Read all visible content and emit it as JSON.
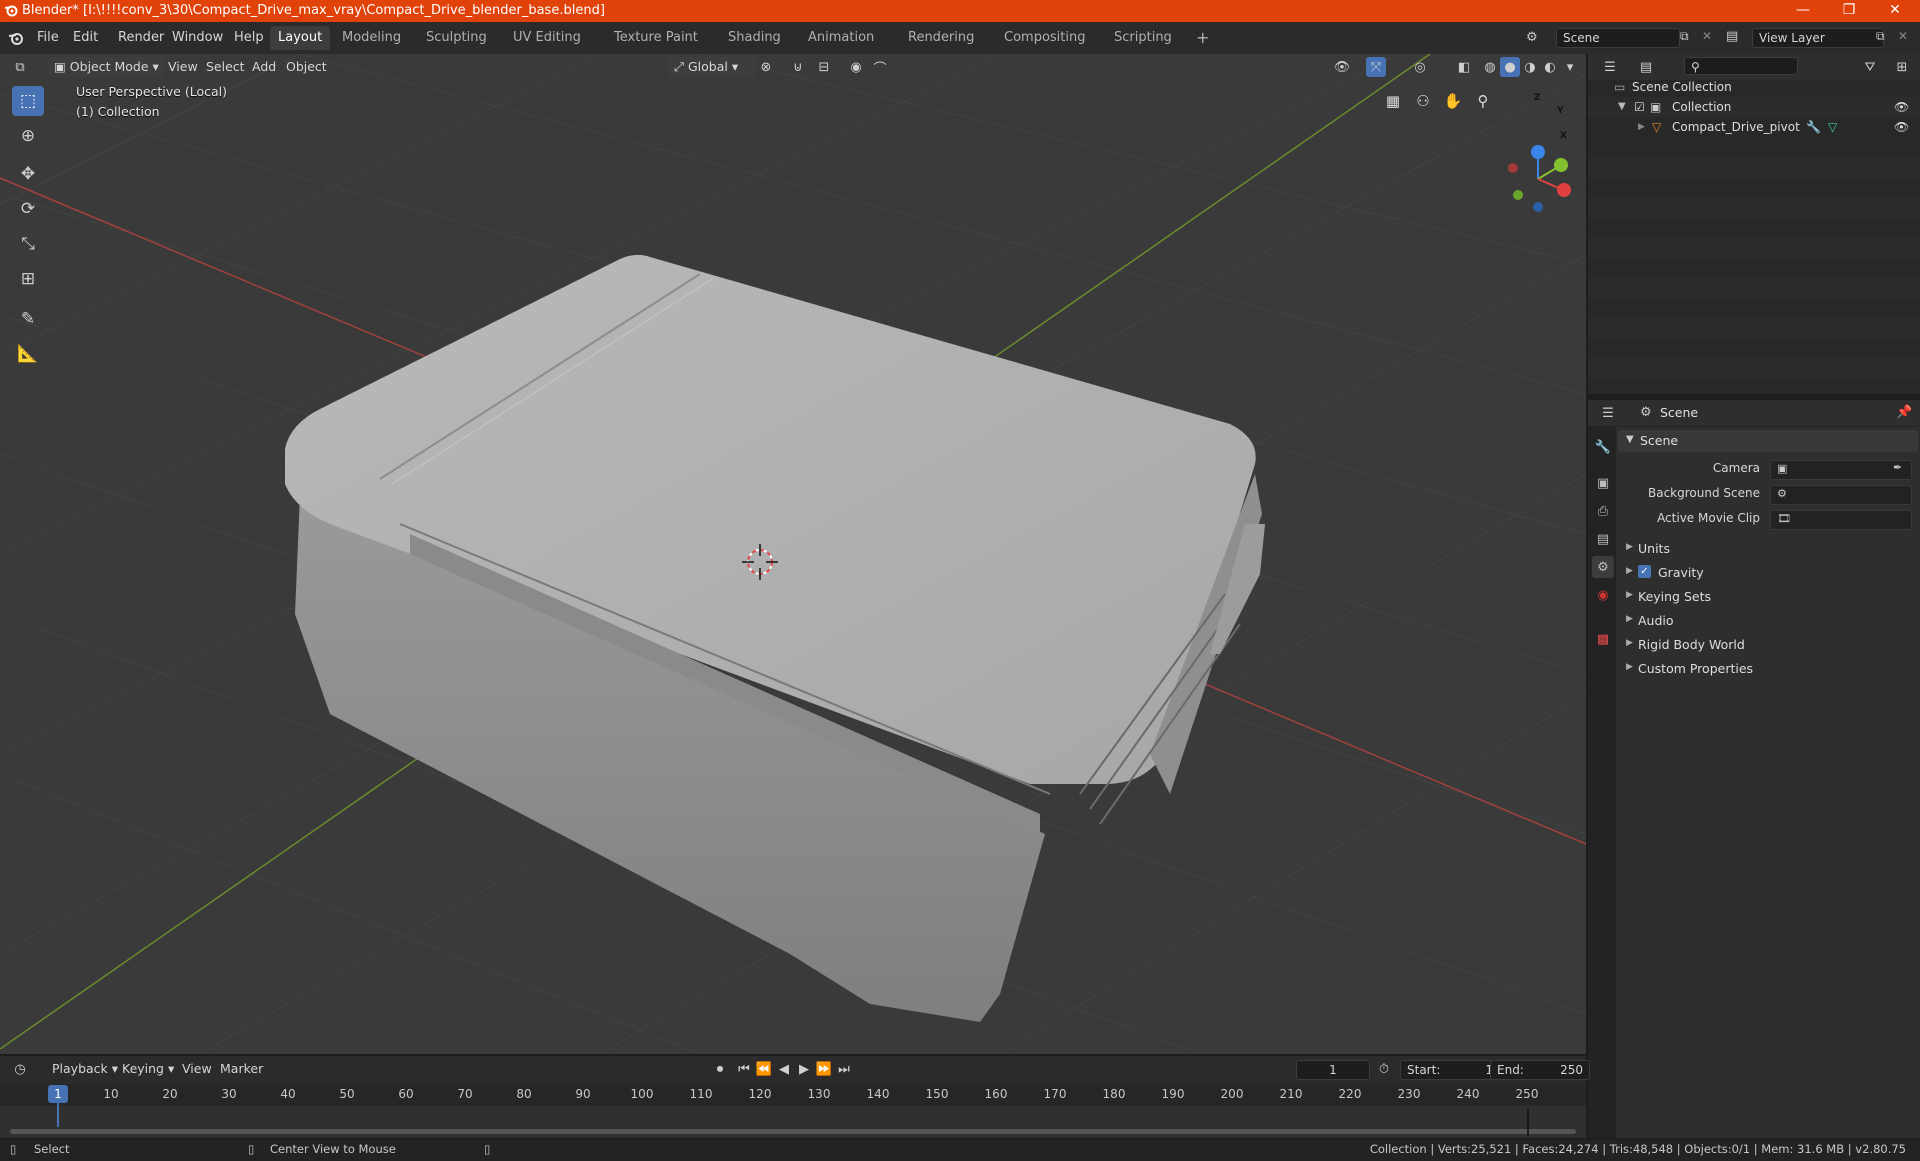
{
  "window": {
    "title": "Blender* [I:\\!!!!conv_3\\30\\Compact_Drive_max_vray\\Compact_Drive_blender_base.blend]",
    "controls": [
      "—",
      "❐",
      "✕"
    ]
  },
  "menubar": {
    "menus": [
      "File",
      "Edit",
      "Render",
      "Window",
      "Help"
    ],
    "workspaces": [
      "Layout",
      "Modeling",
      "Sculpting",
      "UV Editing",
      "Texture Paint",
      "Shading",
      "Animation",
      "Rendering",
      "Compositing",
      "Scripting"
    ],
    "active_workspace": "Layout",
    "add_tab": "+",
    "scene": "Scene",
    "view_layer": "View Layer"
  },
  "viewport": {
    "mode": "Object Mode",
    "menus": [
      "View",
      "Select",
      "Add",
      "Object"
    ],
    "orientation": "Global",
    "perspective_label": "User Perspective (Local)",
    "collection_label": "(1) Collection",
    "gizmo": {
      "x": "X",
      "y": "Y",
      "z": "Z"
    },
    "colors": {
      "x_axis": "#e0413e",
      "y_axis": "#85c12f",
      "z_axis": "#3a86e8",
      "bg": "#3a3a3a"
    }
  },
  "outliner": {
    "scene_collection": "Scene Collection",
    "collection": "Collection",
    "object": "Compact_Drive_pivot"
  },
  "properties": {
    "context": "Scene",
    "section": "Scene",
    "fields": [
      {
        "label": "Camera"
      },
      {
        "label": "Background Scene"
      },
      {
        "label": "Active Movie Clip"
      }
    ],
    "panels": [
      "Units",
      "Gravity",
      "Keying Sets",
      "Audio",
      "Rigid Body World",
      "Custom Properties"
    ]
  },
  "timeline": {
    "menus": [
      "Playback",
      "Keying",
      "View",
      "Marker"
    ],
    "current_frame": "1",
    "start_label": "Start:",
    "start": "1",
    "end_label": "End:",
    "end": "250",
    "ticks": [
      "1",
      "10",
      "20",
      "30",
      "40",
      "50",
      "60",
      "70",
      "80",
      "90",
      "100",
      "110",
      "120",
      "130",
      "140",
      "150",
      "160",
      "170",
      "180",
      "190",
      "200",
      "210",
      "220",
      "230",
      "240",
      "250"
    ]
  },
  "statusbar": {
    "select": "Select",
    "center_view": "Center View to Mouse",
    "stats": "Collection | Verts:25,521 | Faces:24,274 | Tris:48,548 | Objects:0/1 | Mem: 31.6 MB | v2.80.75"
  }
}
